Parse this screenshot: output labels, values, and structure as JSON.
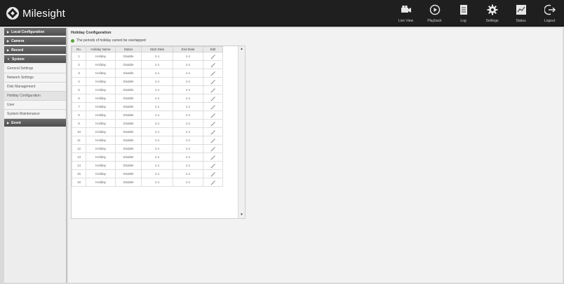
{
  "brand": {
    "name": "Milesight"
  },
  "nav": [
    {
      "label": "Live View",
      "icon": "camera-icon"
    },
    {
      "label": "Playback",
      "icon": "playback-icon"
    },
    {
      "label": "Log",
      "icon": "log-icon"
    },
    {
      "label": "Settings",
      "icon": "gear-icon"
    },
    {
      "label": "Status",
      "icon": "status-icon"
    },
    {
      "label": "Logout",
      "icon": "logout-icon"
    }
  ],
  "sidebar": {
    "sections": [
      {
        "label": "Local Configuration",
        "items": []
      },
      {
        "label": "Camera",
        "items": []
      },
      {
        "label": "Record",
        "items": []
      },
      {
        "label": "System",
        "items": [
          "General Settings",
          "Network Settings",
          "Disk Management",
          "Holiday Configuration",
          "User",
          "System Maintenance"
        ]
      },
      {
        "label": "Event",
        "items": []
      }
    ]
  },
  "main": {
    "title": "Holiday Configuration",
    "notice": "The periods of holiday cannot be overlapped"
  },
  "table": {
    "headers": [
      "No.",
      "Holiday Name",
      "Status",
      "Start Date",
      "End Date",
      "Edit"
    ],
    "rows": [
      [
        "1",
        "Holiday",
        "Disable",
        "1-1",
        "1-1"
      ],
      [
        "2",
        "Holiday",
        "Disable",
        "1-1",
        "1-1"
      ],
      [
        "3",
        "Holiday",
        "Disable",
        "1-1",
        "1-1"
      ],
      [
        "4",
        "Holiday",
        "Disable",
        "1-1",
        "1-1"
      ],
      [
        "5",
        "Holiday",
        "Disable",
        "1-1",
        "1-1"
      ],
      [
        "6",
        "Holiday",
        "Disable",
        "1-1",
        "1-1"
      ],
      [
        "7",
        "Holiday",
        "Disable",
        "1-1",
        "1-1"
      ],
      [
        "8",
        "Holiday",
        "Disable",
        "1-1",
        "1-1"
      ],
      [
        "9",
        "Holiday",
        "Disable",
        "1-1",
        "1-1"
      ],
      [
        "10",
        "Holiday",
        "Disable",
        "1-1",
        "1-1"
      ],
      [
        "11",
        "Holiday",
        "Disable",
        "1-1",
        "1-1"
      ],
      [
        "12",
        "Holiday",
        "Disable",
        "1-1",
        "1-1"
      ],
      [
        "13",
        "Holiday",
        "Disable",
        "1-1",
        "1-1"
      ],
      [
        "14",
        "Holiday",
        "Disable",
        "1-1",
        "1-1"
      ],
      [
        "15",
        "Holiday",
        "Disable",
        "1-1",
        "1-1"
      ],
      [
        "16",
        "Holiday",
        "Disable",
        "1-1",
        "1-1"
      ]
    ]
  }
}
